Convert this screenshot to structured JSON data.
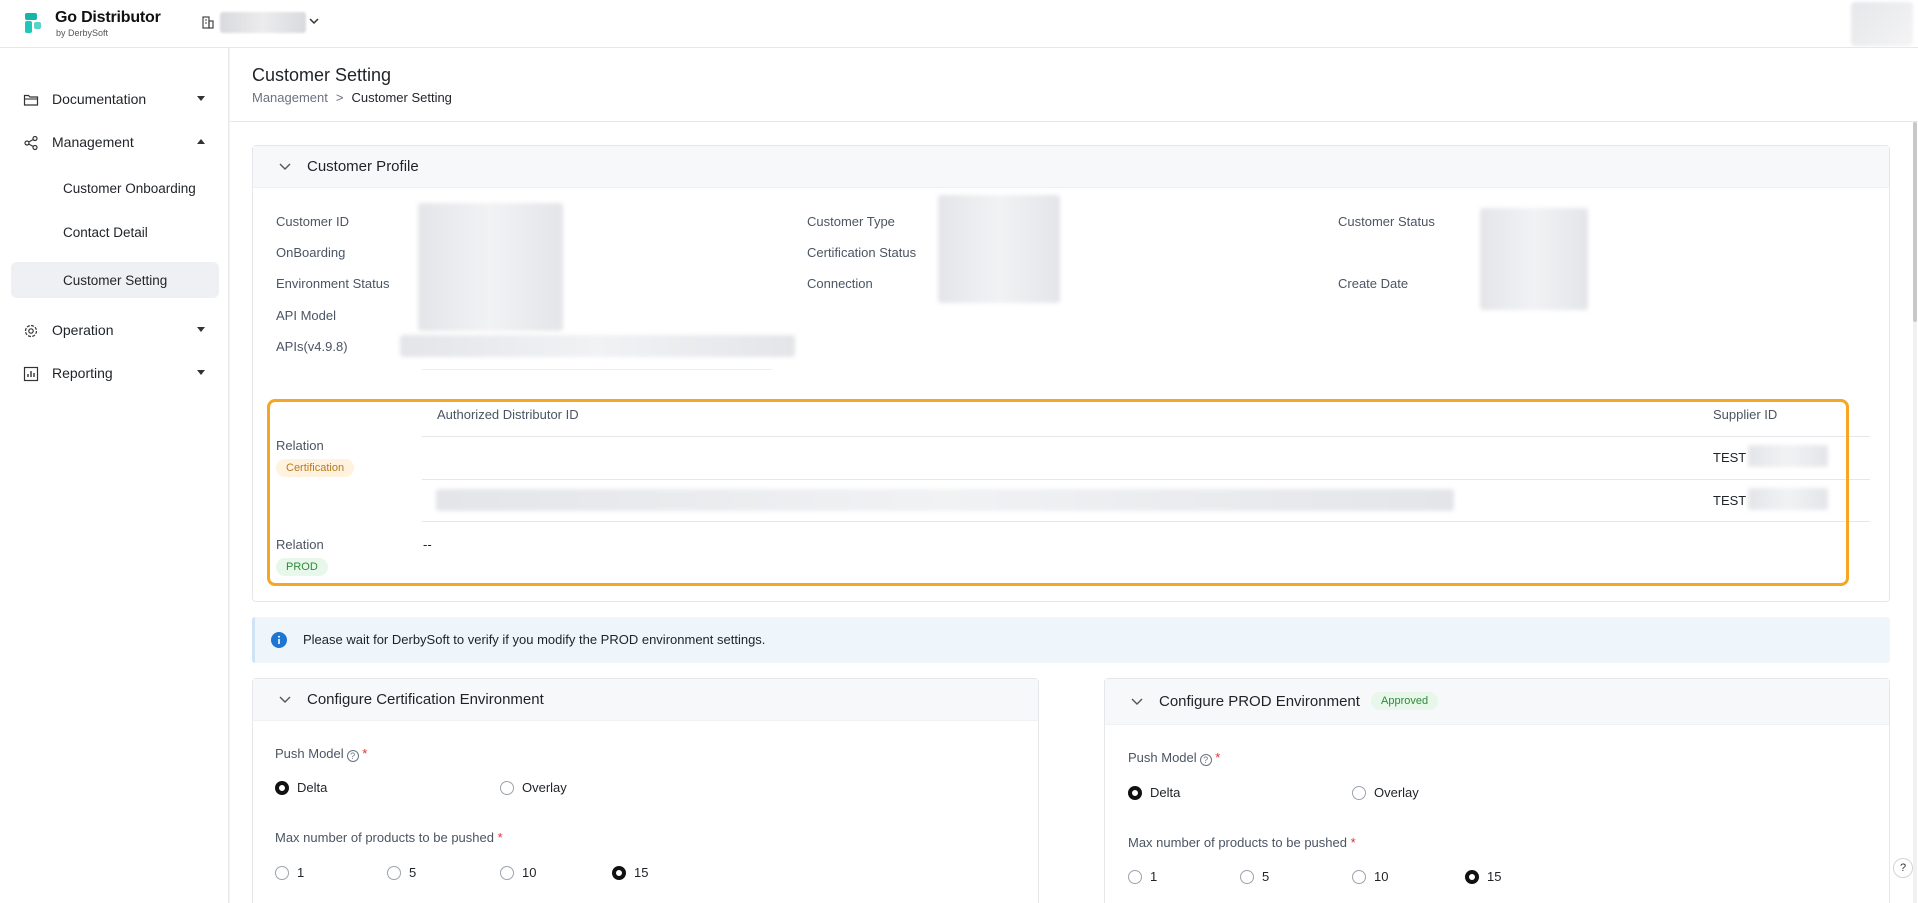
{
  "brand": {
    "title": "Go Distributor",
    "subtitle": "by DerbySoft"
  },
  "sidebar": {
    "documentation": "Documentation",
    "management": "Management",
    "sub_items": [
      "Customer Onboarding",
      "Contact Detail",
      "Customer Setting"
    ],
    "operation": "Operation",
    "reporting": "Reporting"
  },
  "page": {
    "title": "Customer Setting",
    "breadcrumb": {
      "parent": "Management",
      "separator": ">",
      "current": "Customer Setting"
    }
  },
  "profile": {
    "title": "Customer Profile",
    "col1": [
      "Customer ID",
      "OnBoarding",
      "Environment Status",
      "API Model",
      "APIs(v4.9.8)"
    ],
    "col2": [
      "Customer Type",
      "Certification Status",
      "Connection"
    ],
    "col3": [
      "Customer Status",
      "Create Date"
    ],
    "relation": {
      "header_distributor": "Authorized Distributor ID",
      "header_supplier": "Supplier ID",
      "cert_label": "Relation",
      "cert_tag": "Certification",
      "cert_rows": [
        "TEST",
        "TEST"
      ],
      "prod_label": "Relation",
      "prod_tag": "PROD",
      "prod_value": "--"
    }
  },
  "info": "Please wait for DerbySoft to verify if you modify the PROD environment settings.",
  "cert_env": {
    "title": "Configure Certification Environment",
    "push_model_label": "Push Model",
    "push_options": [
      "Delta",
      "Overlay"
    ],
    "push_selected": "Delta",
    "max_label": "Max number of products to be pushed",
    "max_options": [
      "1",
      "5",
      "10",
      "15"
    ],
    "max_selected": "15"
  },
  "prod_env": {
    "title": "Configure PROD Environment",
    "status": "Approved",
    "push_model_label": "Push Model",
    "push_options": [
      "Delta",
      "Overlay"
    ],
    "push_selected": "Delta",
    "max_label": "Max number of products to be pushed",
    "max_options": [
      "1",
      "5",
      "10",
      "15"
    ],
    "max_selected": "15"
  },
  "colors": {
    "highlight": "#f5a623",
    "brand": "#17b5a8"
  }
}
